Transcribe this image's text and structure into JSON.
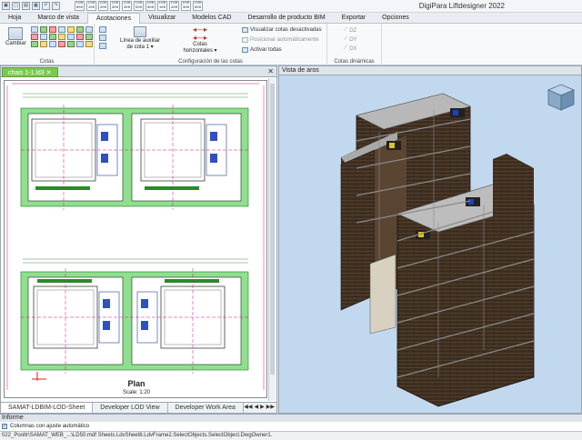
{
  "app": {
    "title": "DigiPara Liftdesigner 2022"
  },
  "layer_buttons": [
    {
      "top": "L00",
      "bottom": "000"
    },
    {
      "top": "L00",
      "bottom": "100"
    },
    {
      "top": "L00",
      "bottom": "200"
    },
    {
      "top": "L00",
      "bottom": "300"
    },
    {
      "top": "L00",
      "bottom": "400"
    },
    {
      "top": "L00",
      "bottom": "500"
    },
    {
      "top": "L00",
      "bottom": "000"
    },
    {
      "top": "L00",
      "bottom": "100"
    },
    {
      "top": "L00",
      "bottom": "200"
    },
    {
      "top": "L00",
      "bottom": "300"
    },
    {
      "top": "L00",
      "bottom": "900"
    }
  ],
  "ribbon_tabs": [
    "Hoja",
    "Marco de vista",
    "Acotaciones",
    "Visualizar",
    "Modelos CAD",
    "Desarrollo de producto BIM",
    "Exportar",
    "Opciones"
  ],
  "active_tab": "Acotaciones",
  "ribbon": {
    "cotas": {
      "label": "Cotas",
      "cambiar": "Cambiar"
    },
    "config": {
      "label": "Configuración de las cotas",
      "linea_auxiliar_1": "Línea de auxiliar",
      "linea_auxiliar_2": "de cota 1",
      "cotas_horizontales_1": "Cotas",
      "cotas_horizontales_2": "horizontales",
      "visualizar_desactivadas": "Visualizar cotas desactivadas",
      "posicionar_auto": "Posicionar automáticamente",
      "activar_todas": "Activar todas"
    },
    "dinamicas": {
      "label": "Cotas dinámicas",
      "dz": "DZ",
      "dy": "DY",
      "dx": "DX"
    }
  },
  "left_panel": {
    "doc_tab": "chais 1-1.ld3",
    "plan_title": "Plan",
    "plan_scale": "Scale: 1:20",
    "sheet_tabs": [
      "SAMAT-LDBIM-LOD-Sheet",
      "Developer LOD View",
      "Developer Work Area"
    ],
    "active_sheet": "SAMAT-LDBIM-LOD-Sheet"
  },
  "right_panel": {
    "title": "Vista de aros"
  },
  "info": {
    "label": "Informe",
    "option": "Columnas con ajuste automático"
  },
  "status": "022_Pooltr\\SAMAT_WEB_...\\LD50.mdf   Sheets.LdvSheet8.LdvFrame2.SelectObjects.SelectObject.DwgOwner1.",
  "colors": {
    "active_doc_tab": "#7dc850",
    "shaft_fill": "#3d2e21",
    "viewport_bg": "#c2d8ef",
    "slab_green": "#8ee08e"
  }
}
